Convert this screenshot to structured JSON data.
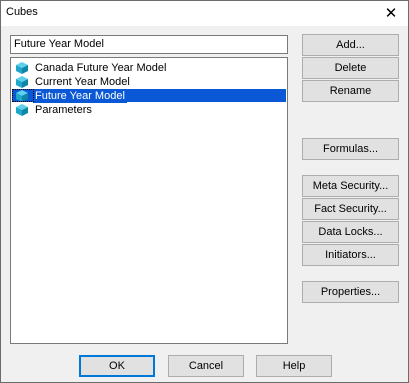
{
  "window": {
    "title": "Cubes"
  },
  "name_field": {
    "value": "Future Year Model"
  },
  "cubes": [
    {
      "label": "Canada Future Year Model",
      "icon": "cube-icon",
      "selected": false
    },
    {
      "label": "Current Year Model",
      "icon": "cube-icon",
      "selected": false
    },
    {
      "label": "Future Year Model",
      "icon": "cube-icon",
      "selected": true
    },
    {
      "label": "Parameters",
      "icon": "cube-icon",
      "selected": false
    }
  ],
  "buttons": {
    "add": "Add...",
    "delete": "Delete",
    "rename": "Rename",
    "formulas": "Formulas...",
    "meta_security": "Meta Security...",
    "fact_security": "Fact Security...",
    "data_locks": "Data Locks...",
    "initiators": "Initiators...",
    "properties": "Properties...",
    "ok": "OK",
    "cancel": "Cancel",
    "help": "Help"
  },
  "colors": {
    "selection": "#0a58d6",
    "cube_icon": "#1fa7c9"
  }
}
